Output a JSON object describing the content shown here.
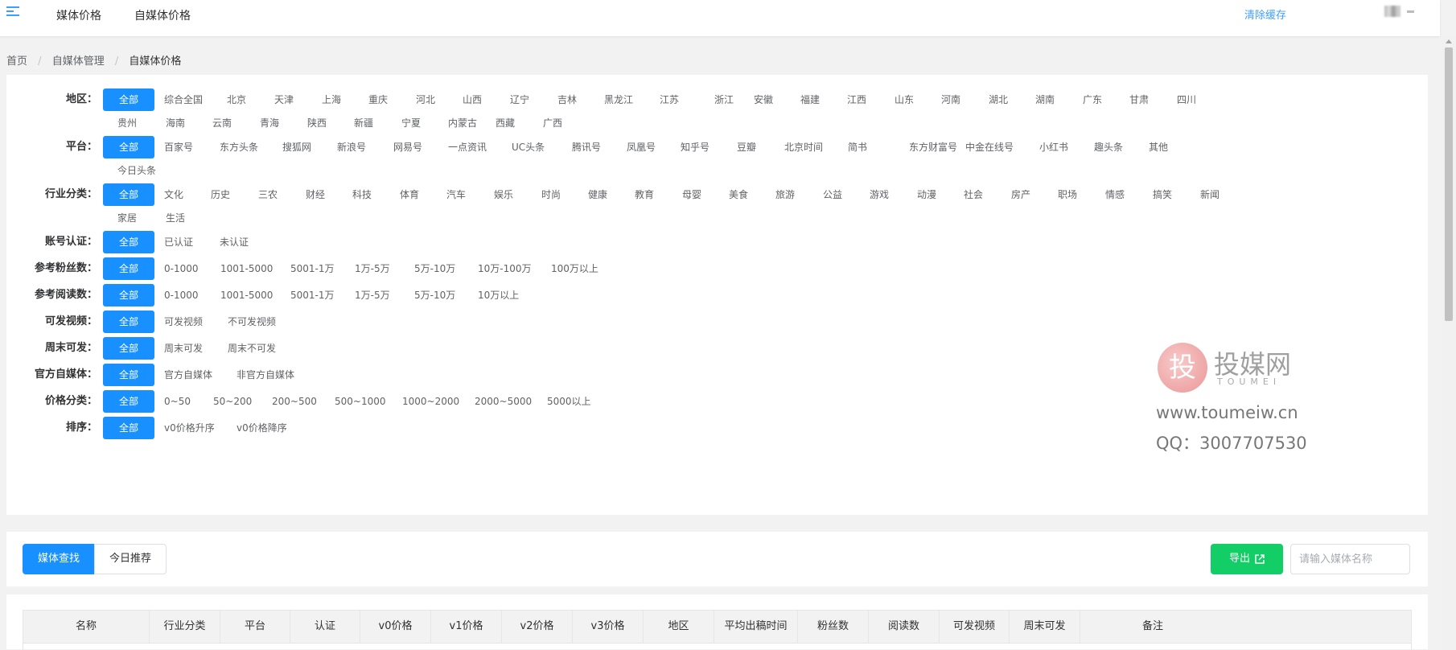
{
  "topbar": {
    "nav1": "媒体价格",
    "nav2": "自媒体价格",
    "clear_cache": "清除缓存"
  },
  "breadcrumb": [
    "首页",
    "自媒体管理",
    "自媒体价格"
  ],
  "breadcrumb_sep": "/",
  "filters": [
    {
      "label": "地区：",
      "rows": [
        [
          "全部",
          "综合全国",
          "北京",
          "天津",
          "上海",
          "重庆",
          "河北",
          "山西",
          "辽宁",
          "吉林",
          "黑龙江",
          "江苏",
          "浙江",
          "安徽",
          "福建",
          "江西",
          "山东",
          "河南",
          "湖北",
          "湖南",
          "广东",
          "甘肃",
          "四川"
        ],
        [
          "贵州",
          "海南",
          "云南",
          "青海",
          "陕西",
          "新疆",
          "宁夏",
          "内蒙古",
          "西藏",
          "广西"
        ]
      ]
    },
    {
      "label": "平台：",
      "rows": [
        [
          "全部",
          "百家号",
          "东方头条",
          "搜狐网",
          "新浪号",
          "网易号",
          "一点资讯",
          "UC头条",
          "腾讯号",
          "凤凰号",
          "知乎号",
          "豆瓣",
          "北京时间",
          "简书",
          "东方财富号",
          "中金在线号",
          "小红书",
          "趣头条",
          "其他"
        ],
        [
          "今日头条"
        ]
      ]
    },
    {
      "label": "行业分类：",
      "rows": [
        [
          "全部",
          "文化",
          "历史",
          "三农",
          "财经",
          "科技",
          "体育",
          "汽车",
          "娱乐",
          "时尚",
          "健康",
          "教育",
          "母婴",
          "美食",
          "旅游",
          "公益",
          "游戏",
          "动漫",
          "社会",
          "房产",
          "职场",
          "情感",
          "搞笑",
          "新闻"
        ],
        [
          "家居",
          "生活"
        ]
      ]
    },
    {
      "label": "账号认证：",
      "rows": [
        [
          "全部",
          "已认证",
          "未认证"
        ]
      ]
    },
    {
      "label": "参考粉丝数：",
      "rows": [
        [
          "全部",
          "0-1000",
          "1001-5000",
          "5001-1万",
          "1万-5万",
          "5万-10万",
          "10万-100万",
          "100万以上"
        ]
      ]
    },
    {
      "label": "参考阅读数：",
      "rows": [
        [
          "全部",
          "0-1000",
          "1001-5000",
          "5001-1万",
          "1万-5万",
          "5万-10万",
          "10万以上"
        ]
      ]
    },
    {
      "label": "可发视频：",
      "rows": [
        [
          "全部",
          "可发视频",
          "不可发视频"
        ]
      ]
    },
    {
      "label": "周末可发：",
      "rows": [
        [
          "全部",
          "周末可发",
          "周末不可发"
        ]
      ]
    },
    {
      "label": "官方自媒体：",
      "rows": [
        [
          "全部",
          "官方自媒体",
          "非官方自媒体"
        ]
      ]
    },
    {
      "label": "价格分类：",
      "rows": [
        [
          "全部",
          "0~50",
          "50~200",
          "200~500",
          "500~1000",
          "1000~2000",
          "2000~5000",
          "5000以上"
        ]
      ]
    },
    {
      "label": "排序：",
      "rows": [
        [
          "全部",
          "v0价格升序",
          "v0价格降序"
        ]
      ]
    }
  ],
  "watermark": {
    "glyph": "投",
    "name": "投媒网",
    "sub": "TOUMEI",
    "url": "www.toumeiw.cn",
    "qq": "QQ：3007707530"
  },
  "toolbar": {
    "tab_search": "媒体查找",
    "tab_recommend": "今日推荐",
    "export_label": "导出",
    "search_placeholder": "请输入媒体名称"
  },
  "table": {
    "columns": [
      "名称",
      "行业分类",
      "平台",
      "认证",
      "v0价格",
      "v1价格",
      "v2价格",
      "v3价格",
      "地区",
      "平均出稿时间",
      "粉丝数",
      "阅读数",
      "可发视频",
      "周末可发",
      "备注"
    ]
  },
  "colors": {
    "primary": "#1890ff",
    "export": "#13ce66",
    "link": "#409eff"
  }
}
